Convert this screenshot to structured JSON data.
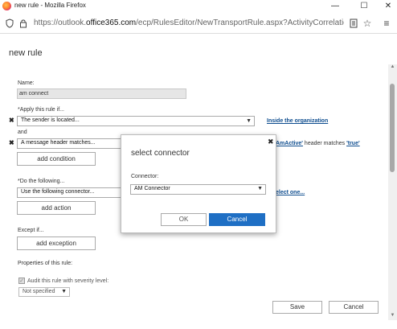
{
  "window": {
    "title": "new rule - Mozilla Firefox"
  },
  "urlbar": {
    "url_prefix": "https://outlook.",
    "url_host": "office365.com",
    "url_rest": "/ecp/RulesEditor/NewTransportRule.aspx?ActivityCorrelationID=f7251c"
  },
  "page": {
    "title": "new rule",
    "name_label": "Name:",
    "name_value": "am connect",
    "apply_label": "*Apply this rule if...",
    "condition1": "The sender is located...",
    "condition1_link": "Inside the organization",
    "and_label": "and",
    "condition2": "A message header matches...",
    "condition2_detail_link1": "AmActive'",
    "condition2_detail_text": "header matches",
    "condition2_detail_link2": "'true'",
    "add_condition": "add condition",
    "do_label": "*Do the following...",
    "action1": "Use the following connector...",
    "action1_link": "elect one...",
    "add_action": "add action",
    "except_label": "Except if...",
    "add_exception": "add exception",
    "properties_label": "Properties of this rule:",
    "audit_label": "Audit this rule with severity level:",
    "severity_value": "Not specified",
    "save": "Save",
    "cancel": "Cancel"
  },
  "dialog": {
    "title": "select connector",
    "connector_label": "Connector:",
    "connector_value": "AM Connector",
    "ok": "OK",
    "cancel": "Cancel"
  },
  "icons": {
    "close": "close-icon",
    "chevron": "chevron-down-icon"
  }
}
